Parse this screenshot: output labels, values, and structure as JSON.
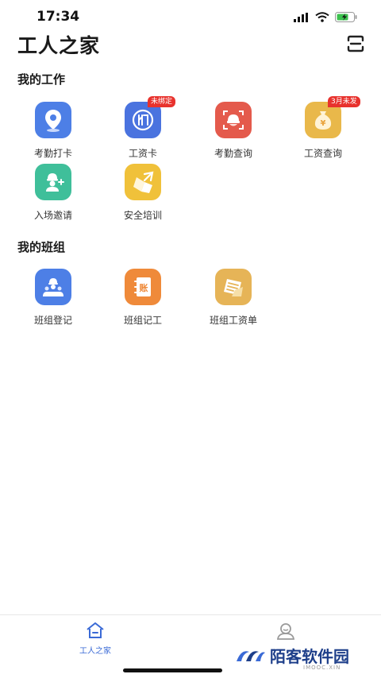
{
  "status": {
    "time": "17:34"
  },
  "header": {
    "title": "工人之家"
  },
  "my_work": {
    "title": "我的工作",
    "items": [
      {
        "label": "考勤打卡",
        "icon": "location-pin-icon",
        "color": "#4d7fe6",
        "badge": ""
      },
      {
        "label": "工资卡",
        "icon": "bank-card-icon",
        "color": "#4a73df",
        "badge": "未绑定"
      },
      {
        "label": "考勤查询",
        "icon": "face-scan-icon",
        "color": "#e45a4c",
        "badge": ""
      },
      {
        "label": "工资查询",
        "icon": "money-bag-icon",
        "color": "#e9b84a",
        "badge": "3月未发"
      },
      {
        "label": "入场邀请",
        "icon": "worker-invite-icon",
        "color": "#3fbf9a",
        "badge": ""
      },
      {
        "label": "安全培训",
        "icon": "safety-helmet-icon",
        "color": "#f0c13a",
        "badge": ""
      }
    ]
  },
  "my_team": {
    "title": "我的班组",
    "items": [
      {
        "label": "班组登记",
        "icon": "team-icon",
        "color": "#4d7fe6"
      },
      {
        "label": "班组记工",
        "icon": "ledger-icon",
        "color": "#ef8a3a",
        "glyph": "账"
      },
      {
        "label": "班组工资单",
        "icon": "payslip-icon",
        "color": "#e6b457"
      }
    ]
  },
  "tabbar": {
    "tabs": [
      {
        "label": "工人之家",
        "icon": "home-icon",
        "active": true
      },
      {
        "label": "",
        "icon": "user-profile-icon",
        "active": false
      }
    ],
    "active_color": "#3a6ad6",
    "inactive_color": "#9a9a9a"
  },
  "watermark": {
    "text": "陌客软件园",
    "sub": "IMOOC.XIN"
  }
}
